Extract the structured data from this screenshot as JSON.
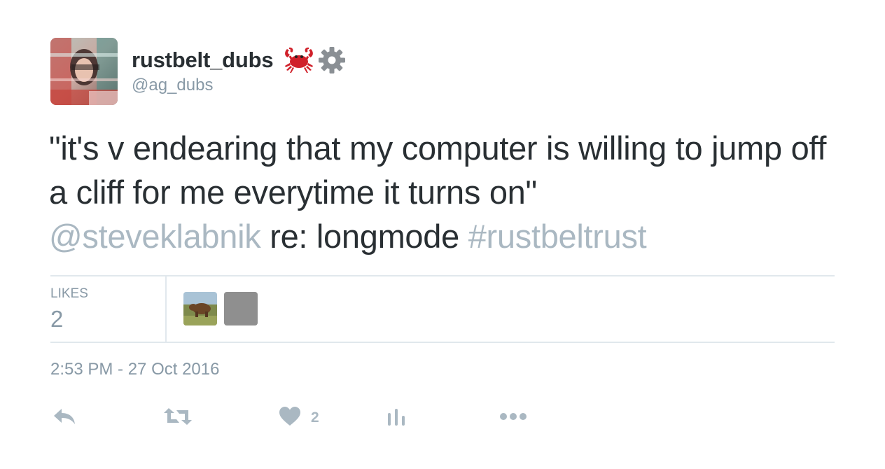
{
  "user": {
    "display_name": "rustbelt_dubs",
    "handle": "@ag_dubs",
    "emoji": "crab-emoji",
    "badge": "gear-emoji"
  },
  "tweet": {
    "text_main": "\"it's v endearing that my computer is willing to jump off a cliff for me everytime it turns on\"",
    "mention": "@steveklabnik",
    "text_middle": " re: longmode ",
    "hashtag": "#rustbeltrust"
  },
  "stats": {
    "likes_label": "LIKES",
    "likes_count": "2"
  },
  "timestamp": "2:53 PM - 27 Oct 2016",
  "actions": {
    "reply_icon": "reply-icon",
    "retweet_icon": "retweet-icon",
    "like_icon": "heart-icon",
    "like_count": "2",
    "analytics_icon": "analytics-icon",
    "more_icon": "more-icon"
  },
  "colors": {
    "text": "#292f33",
    "muted": "#8899a6",
    "link": "#aab8c2",
    "divider": "#e1e8ed",
    "crab": "#d0202a"
  }
}
